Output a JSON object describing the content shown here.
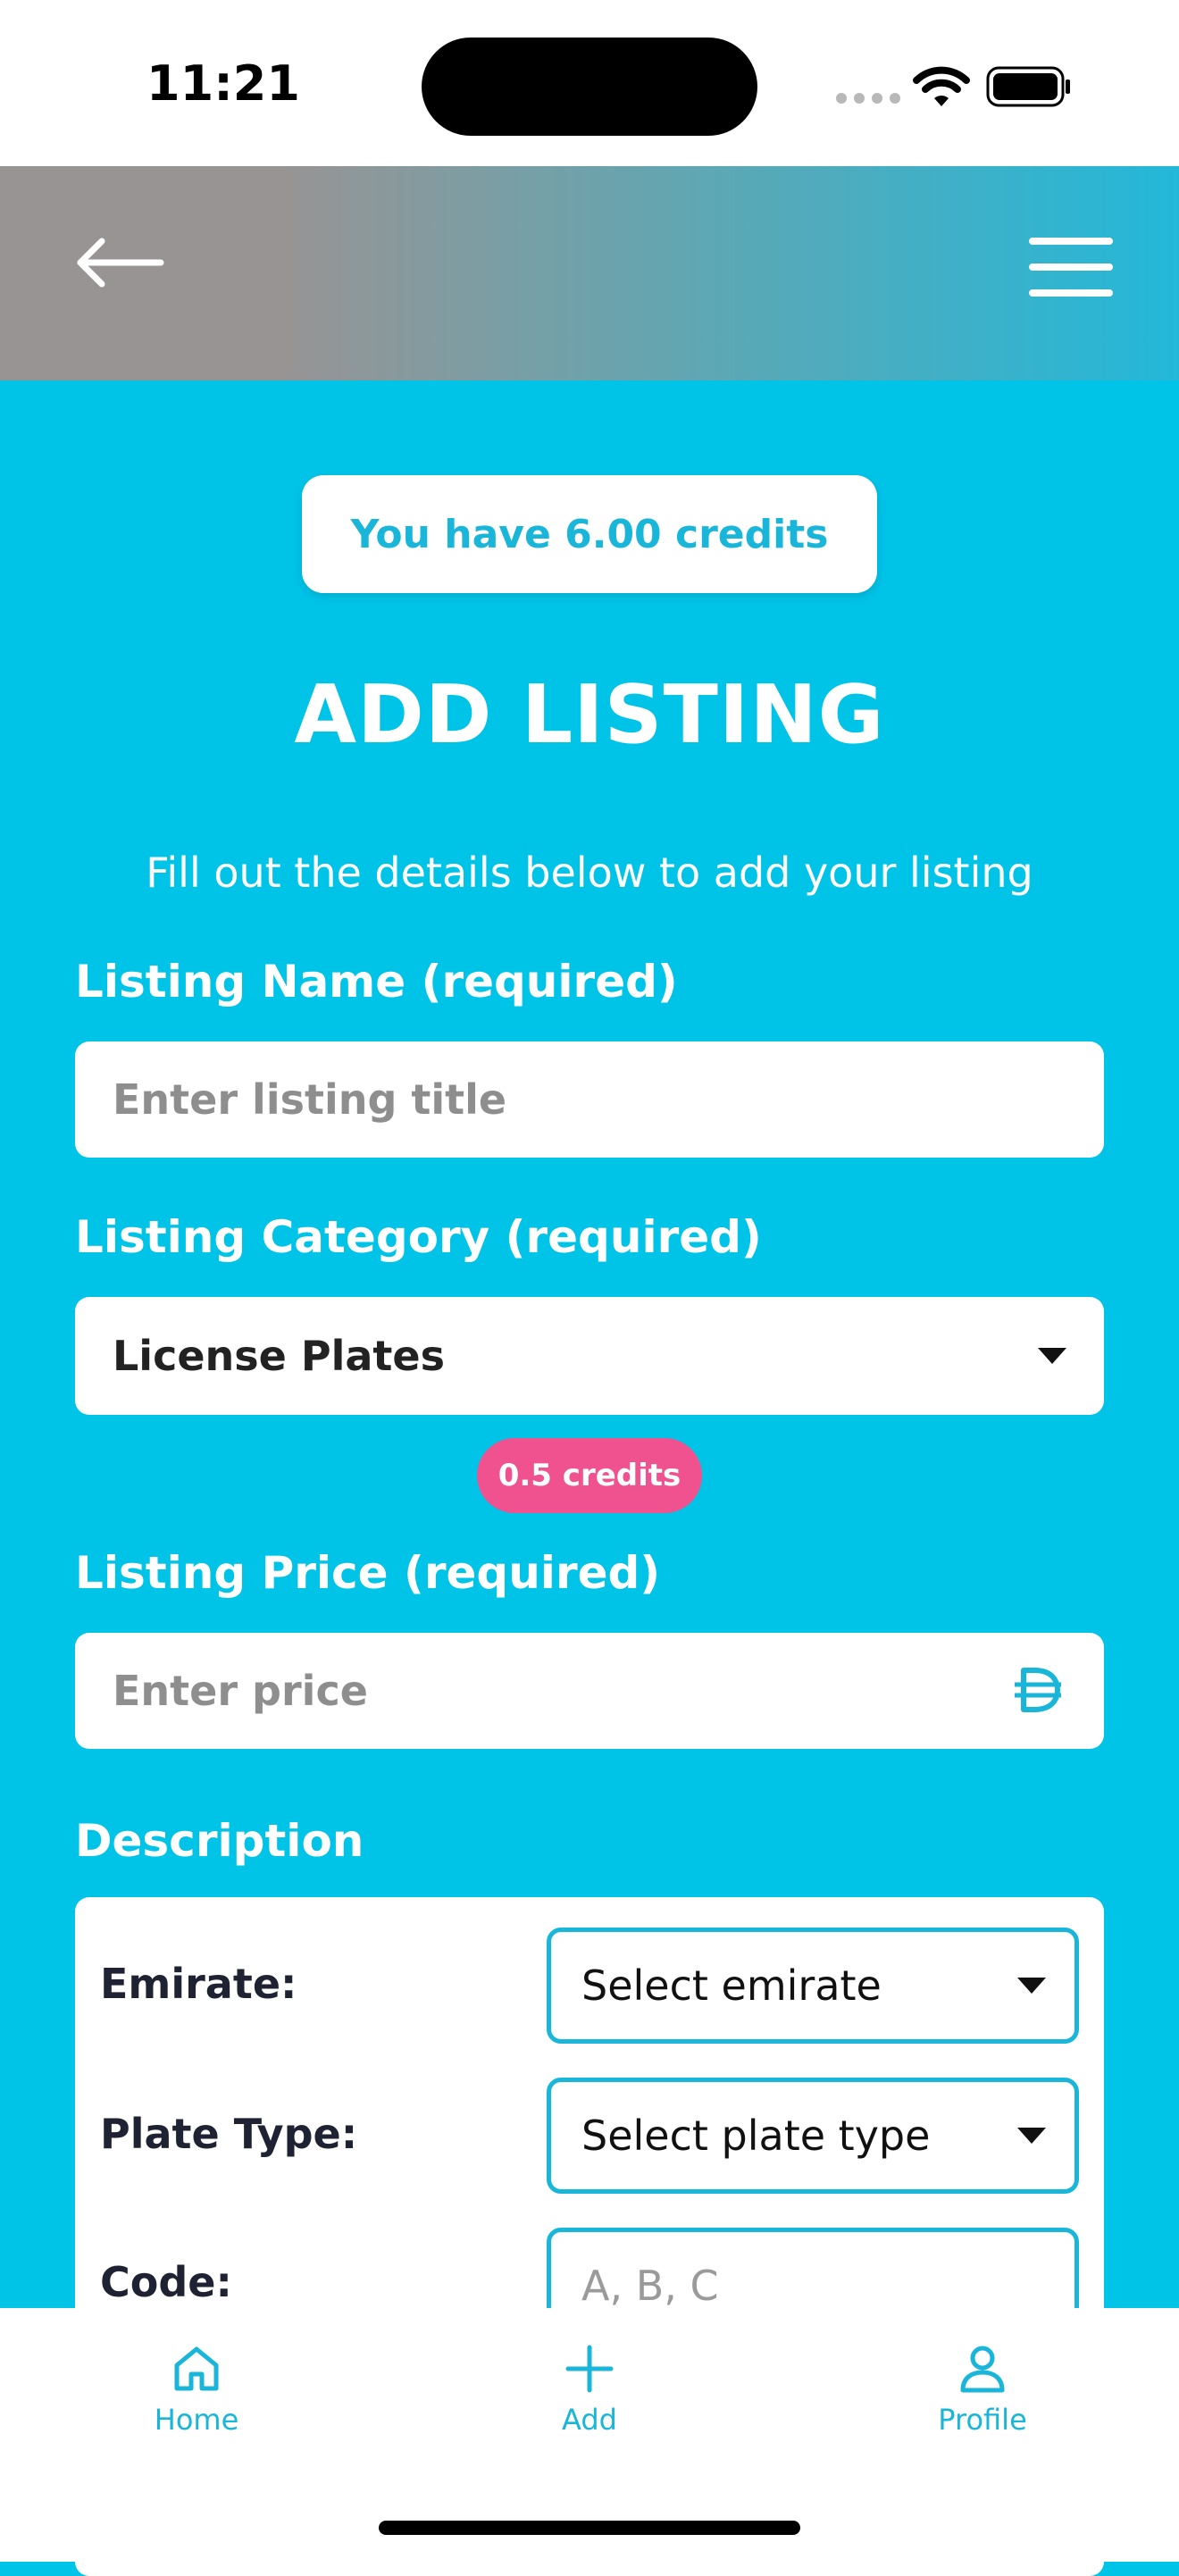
{
  "status_bar": {
    "time": "11:21"
  },
  "credits": {
    "label": "You have 6.00 credits"
  },
  "page": {
    "title": "ADD LISTING",
    "subtitle": "Fill out the details below to add your listing"
  },
  "form": {
    "listing_name": {
      "label": "Listing Name (required)",
      "placeholder": "Enter listing title"
    },
    "listing_category": {
      "label": "Listing Category (required)",
      "value": "License Plates",
      "cost": "0.5 credits"
    },
    "listing_price": {
      "label": "Listing Price (required)",
      "placeholder": "Enter price"
    },
    "description": {
      "label": "Description",
      "emirate": {
        "label": "Emirate:",
        "value": "Select emirate"
      },
      "plate_type": {
        "label": "Plate Type:",
        "value": "Select plate type"
      },
      "code": {
        "label": "Code:",
        "placeholder": "A, B, C"
      }
    }
  },
  "tab_bar": {
    "items": [
      {
        "label": "Home",
        "icon": "home-icon"
      },
      {
        "label": "Add",
        "icon": "plus-icon"
      },
      {
        "label": "Profile",
        "icon": "person-icon"
      }
    ]
  },
  "colors": {
    "primary": "#00c3e8",
    "accent_text": "#1ab6da",
    "badge": "#f0528f",
    "white": "#ffffff"
  }
}
